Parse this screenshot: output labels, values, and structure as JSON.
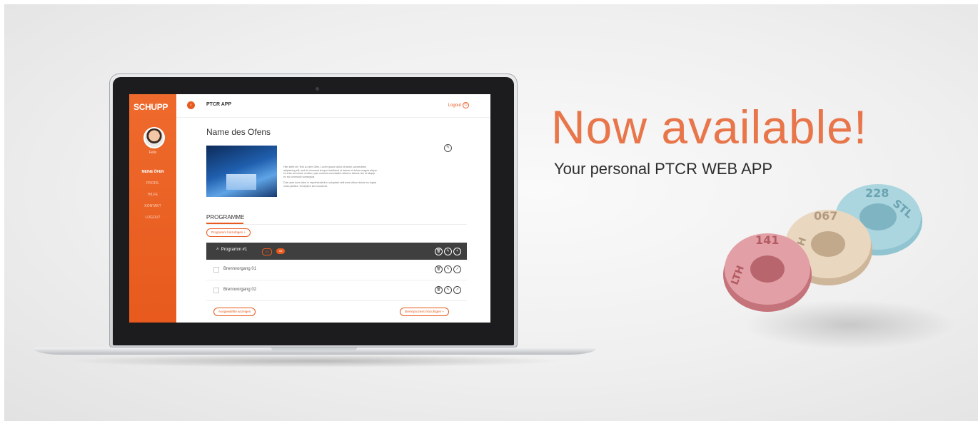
{
  "app": {
    "logo": "SCHUPP",
    "title": "PTCR APP",
    "logout_label": "Logout",
    "user_name": "Felix",
    "menu": [
      "MEINE ÖFEN",
      "PROFIL",
      "HILFE",
      "KONTAKT",
      "LOGOUT"
    ],
    "oven_name": "Name des Ofens",
    "description": [
      "Hier steht ein Text zu dem Ofen. Lorem ipsum dolor sit amet, consectetur adipisicing elit, sed do eiusmod tempor incididunt ut labore et dolore magna aliqua. Ut enim ad minim veniam, quis nostrud exercitation ullamco laboris nisi ut aliquip ex ea commodo consequat.",
      "Duis aute irure dolor in reprehenderit in voluptate velit esse cillum dolore eu fugiat nulla pariatur. Excepteur sint occaecat."
    ],
    "section_tab": "PROGRAMME",
    "add_program_label": "Programm hinzufügen",
    "program": {
      "name": "Programm #1",
      "badge_1": "02",
      "badge_2": "05"
    },
    "rows": [
      {
        "label": "Brennvorgang 01"
      },
      {
        "label": "Brennvorgang 02"
      }
    ],
    "show_selected_label": "Ausgewählte anzeigen",
    "add_firing_label": "Brennprozess hinzufügen"
  },
  "headline": "Now available!",
  "subline": "Your personal PTCR WEB APP",
  "rings": [
    {
      "label_top": "141",
      "label_side": "LTH",
      "color": "#d98b93"
    },
    {
      "label_top": "067",
      "label_side": "ETH",
      "color": "#e8d2b8"
    },
    {
      "label_top": "228",
      "label_side": "STL",
      "color": "#a9d3dc"
    }
  ],
  "colors": {
    "accent": "#e85a1e",
    "headline": "#e8764a"
  }
}
